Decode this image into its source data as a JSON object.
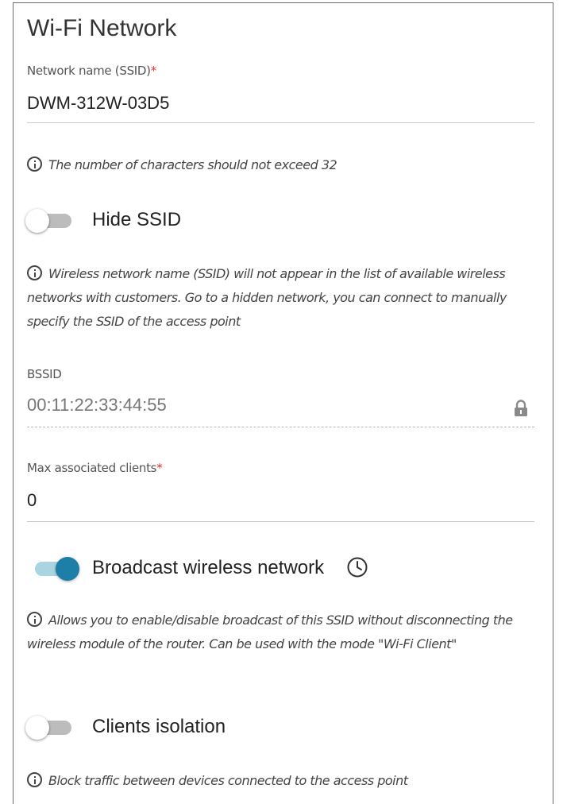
{
  "section": {
    "title": "Wi-Fi Network"
  },
  "ssid": {
    "label": "Network name (SSID)",
    "required_mark": "*",
    "value": "DWM-312W-03D5",
    "hint": "The number of characters should not exceed 32"
  },
  "hide_ssid": {
    "label": "Hide SSID",
    "enabled": false,
    "hint": "Wireless network name (SSID) will not appear in the list of available wireless networks with customers. Go to a hidden network, you can connect to manually specify the SSID of the access point"
  },
  "bssid": {
    "label": "BSSID",
    "value": "00:11:22:33:44:55",
    "icon": "lock-icon"
  },
  "max_clients": {
    "label": "Max associated clients",
    "required_mark": "*",
    "value": "0"
  },
  "broadcast": {
    "label": "Broadcast wireless network",
    "enabled": true,
    "icon": "clock-icon",
    "hint": "Allows you to enable/disable broadcast of this SSID without disconnecting the wireless module of the router. Can be used with the mode \"Wi-Fi Client\""
  },
  "clients_isolation": {
    "label": "Clients isolation",
    "enabled": false,
    "hint": "Block traffic between devices connected to the access point"
  },
  "colors": {
    "accent": "#1d7fa8",
    "accent_track": "#a9d4e2",
    "required": "#e8312f",
    "toggle_off_track": "#bcbcbc"
  }
}
